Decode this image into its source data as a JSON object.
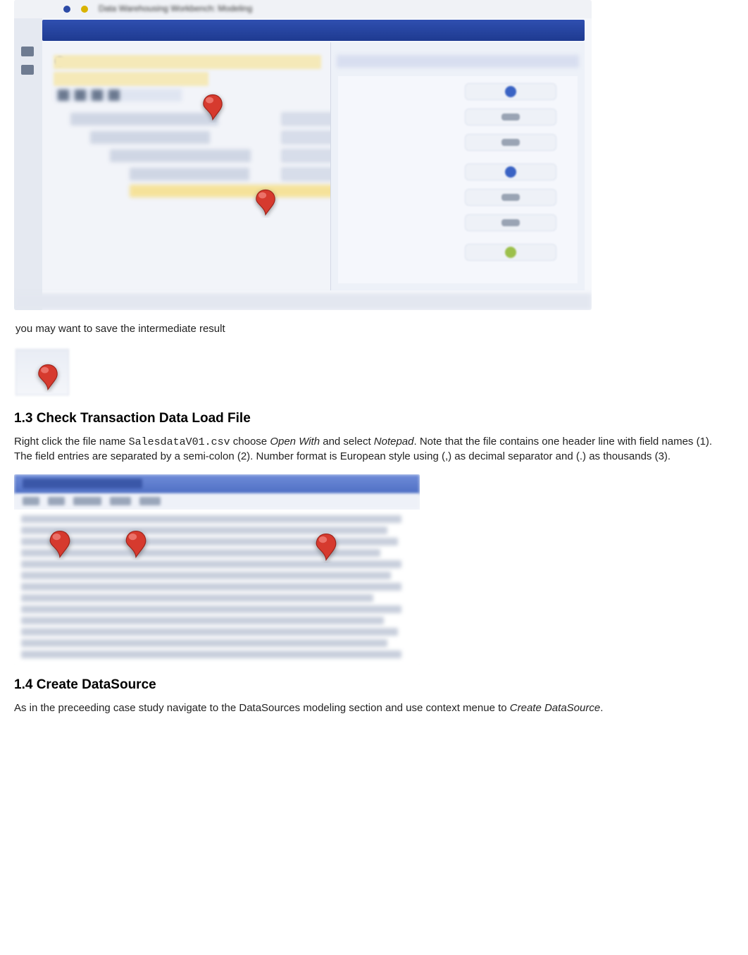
{
  "shot1": {
    "app_title": "Data Warehousing Workbench: Modeling",
    "tree": {
      "l1": "InfoProvider",
      "l2": "Characteristics",
      "l3": "InfoObjects",
      "l4": "Unassigned Nodes",
      "highlight": "ZCOSTCTR Attributes from ZCUSTLOC"
    },
    "statusbar_text": ""
  },
  "caption1": "you may want to save the intermediate result",
  "section13_title": "1.3 Check Transaction Data Load File",
  "para13_a": "Right click the file name ",
  "para13_file": "SalesdataV01.csv",
  "para13_b": " choose ",
  "para13_openwith": "Open With",
  "para13_c": " and select ",
  "para13_notepad": "Notepad",
  "para13_d": ". Note that the file contains one header line with field names (1). The field entries are separated by a semi-colon (2). Number format is European style using (,) as decimal separator and (.) as thousands (3).",
  "notepad": {
    "title": "SalesdataV01 - Notepad",
    "menu": [
      "File",
      "Edit",
      "Format",
      "View",
      "Help"
    ]
  },
  "section14_title": "1.4 Create DataSource",
  "para14_a": "As in the preceeding case study navigate to the DataSources modeling section and use context menue to ",
  "para14_em": "Create DataSource",
  "para14_b": "."
}
